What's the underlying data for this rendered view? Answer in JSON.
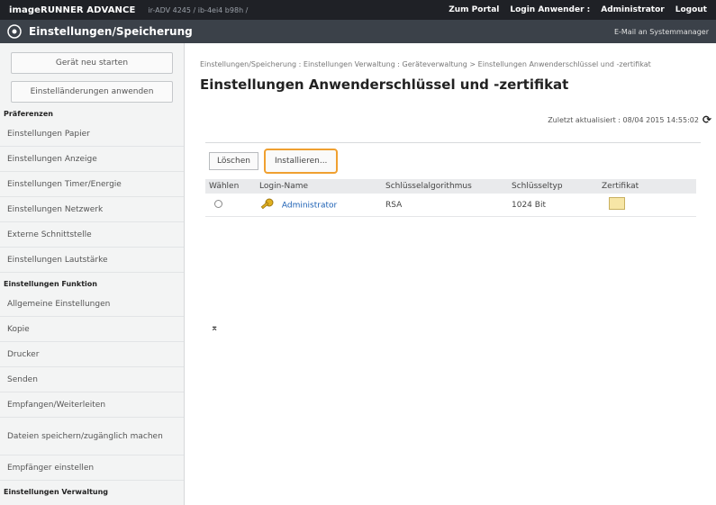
{
  "topbar": {
    "brand": "imageRUNNER ADVANCE",
    "device": "ir-ADV 4245 / ib-4ei4 b98h /",
    "portal": "Zum Portal",
    "login_user": "Login Anwender :",
    "user_name": "Administrator",
    "logout": "Logout"
  },
  "titlebar": {
    "title": "Einstellungen/Speicherung",
    "email": "E-Mail an Systemmanager"
  },
  "sidebar": {
    "restart": "Gerät neu starten",
    "apply": "Einstelländerungen anwenden",
    "sections": [
      {
        "heading": "Präferenzen",
        "items": [
          "Einstellungen Papier",
          "Einstellungen Anzeige",
          "Einstellungen Timer/Energie",
          "Einstellungen Netzwerk",
          "Externe Schnittstelle",
          "Einstellungen Lautstärke"
        ]
      },
      {
        "heading": "Einstellungen Funktion",
        "items": [
          "Allgemeine Einstellungen",
          "Kopie",
          "Drucker",
          "Senden",
          "Empfangen/Weiterleiten",
          "Dateien speichern/zugänglich machen",
          "Empfänger einstellen"
        ]
      },
      {
        "heading": "Einstellungen Verwaltung",
        "items": []
      }
    ]
  },
  "main": {
    "breadcrumb": "Einstellungen/Speicherung : Einstellungen Verwaltung : Geräteverwaltung > Einstellungen Anwenderschlüssel und -zertifikat",
    "title": "Einstellungen Anwenderschlüssel und -zertifikat",
    "updated": "Zuletzt aktualisiert : 08/04 2015 14:55:02",
    "buttons": {
      "delete": "Löschen",
      "install": "Installieren..."
    },
    "columns": [
      "Wählen",
      "Login-Name",
      "Schlüsselalgorithmus",
      "Schlüsseltyp",
      "Zertifikat"
    ],
    "rows": [
      {
        "login": "Administrator",
        "algorithm": "RSA",
        "type": "1024 Bit"
      }
    ],
    "to_top": "⌅"
  }
}
